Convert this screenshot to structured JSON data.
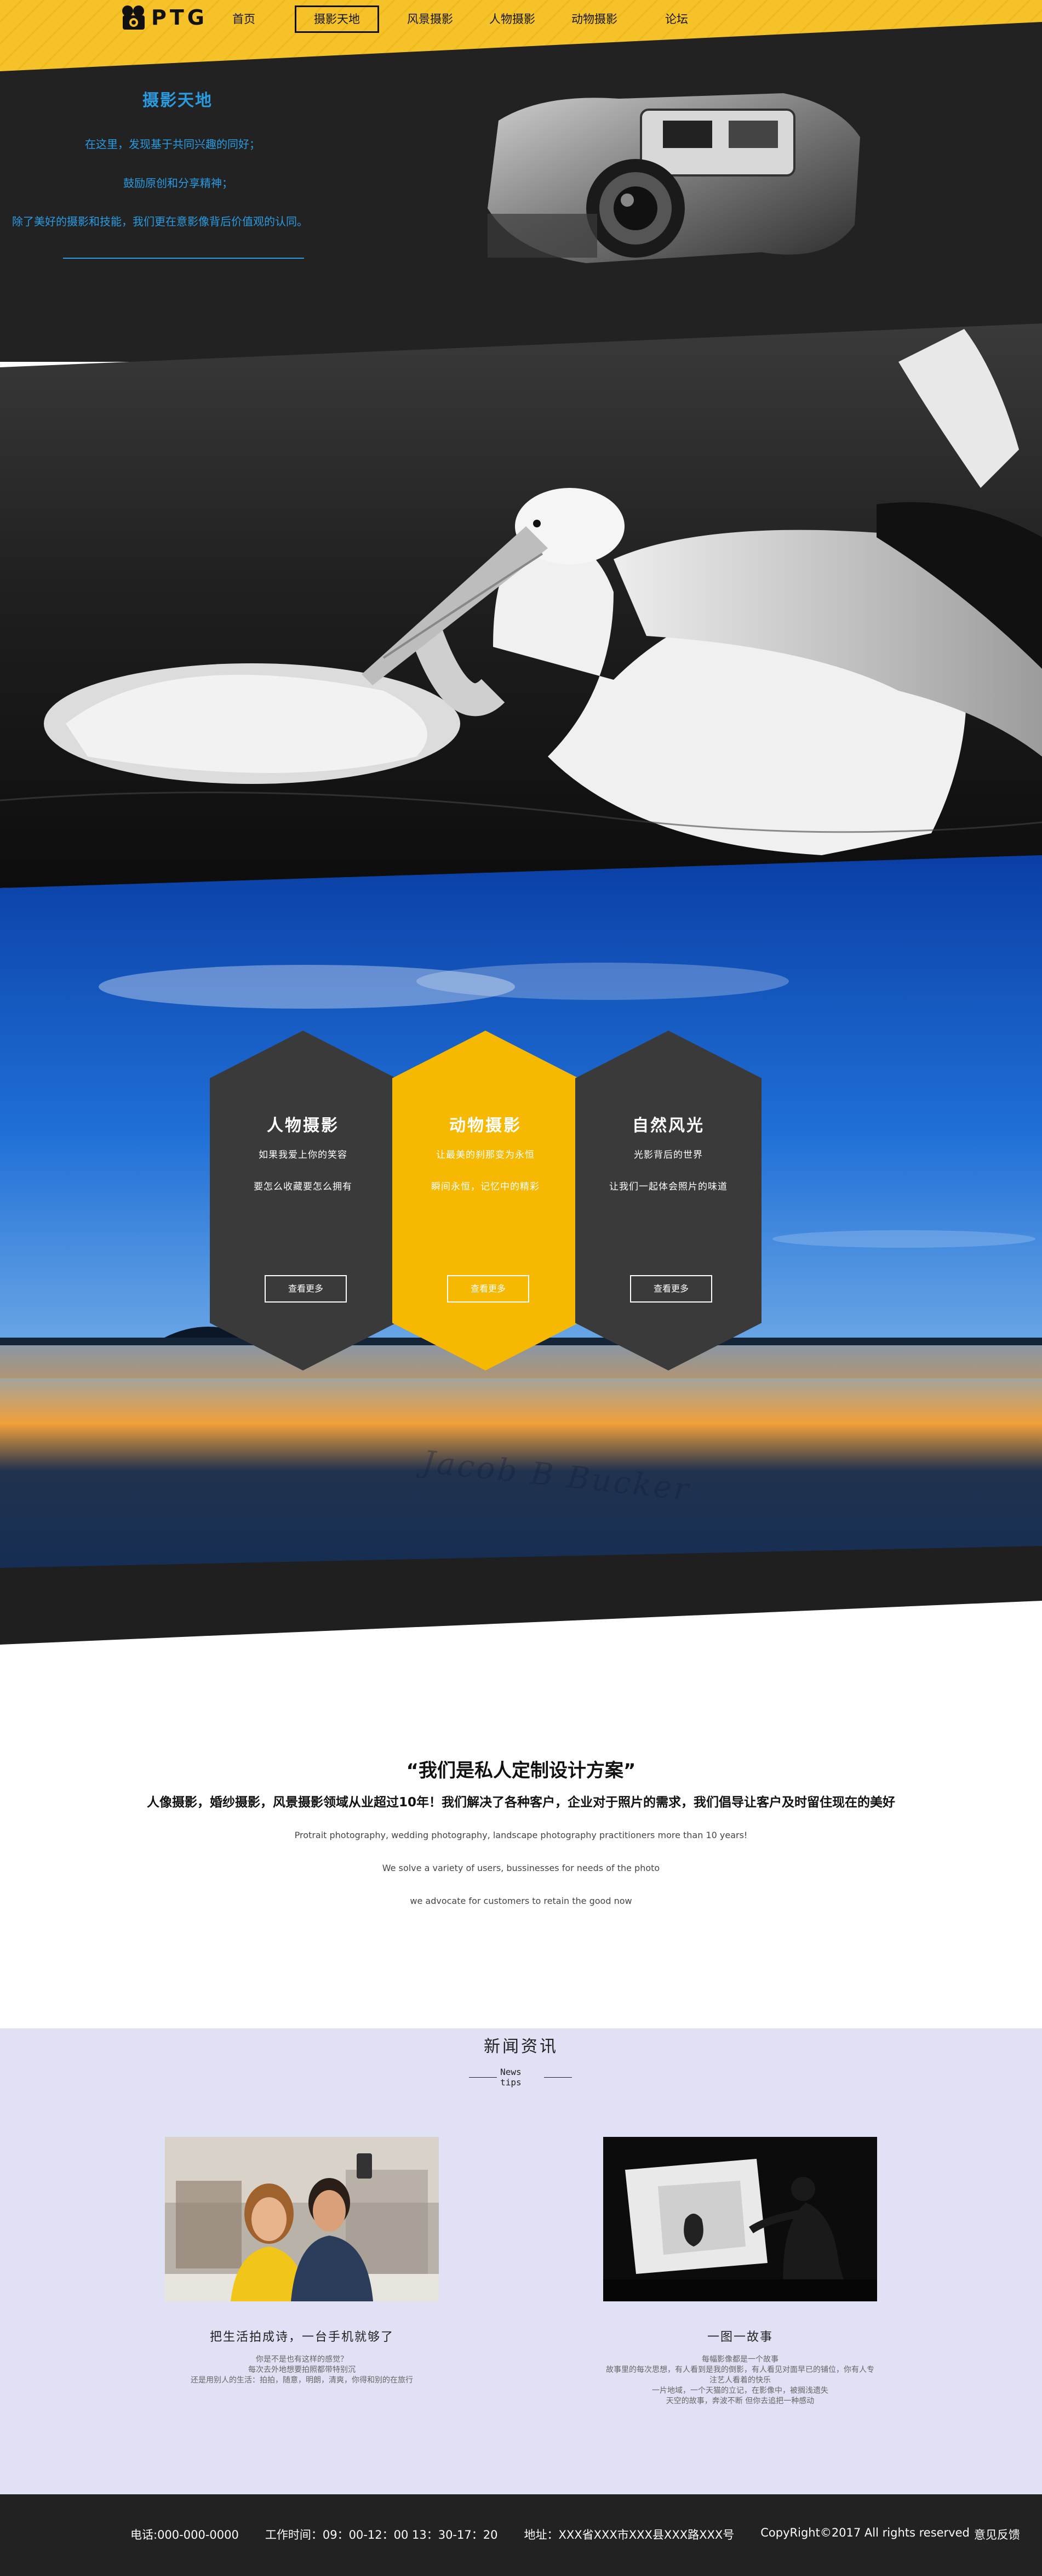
{
  "brand": {
    "logo_text": "PTG",
    "accent": "#f6c229",
    "dark": "#222222",
    "blue": "#2a9be0"
  },
  "nav": {
    "items": [
      {
        "label": "首页",
        "active": false
      },
      {
        "label": "摄影天地",
        "active": true
      },
      {
        "label": "风景摄影",
        "active": false
      },
      {
        "label": "人物摄影",
        "active": false
      },
      {
        "label": "动物摄影",
        "active": false
      },
      {
        "label": "论坛",
        "active": false
      }
    ]
  },
  "intro": {
    "title": "摄影天地",
    "lines": [
      "在这里，发现基于共同兴趣的同好；",
      "鼓励原创和分享精神；",
      "除了美好的摄影和技能，我们更在意影像背后价值观的认同。"
    ]
  },
  "cards": [
    {
      "title": "人物摄影",
      "line1": "如果我爱上你的笑容",
      "line2": "要怎么收藏要怎么拥有",
      "button": "查看更多",
      "color": "#3a3a3a"
    },
    {
      "title": "动物摄影",
      "line1": "让最美的刹那变为永恒",
      "line2": "瞬间永恒，记忆中的精彩",
      "button": "查看更多",
      "color": "#f6b800"
    },
    {
      "title": "自然风光",
      "line1": "光影背后的世界",
      "line2": "让我们一起体会照片的味道",
      "button": "查看更多",
      "color": "#3a3a3a"
    }
  ],
  "about": {
    "title": "“我们是私人定制设计方案”",
    "subtitle": "人像摄影，婚纱摄影，风景摄影领域从业超过10年！我们解决了各种客户，企业对于照片的需求，我们倡导让客户及时留住现在的美好",
    "en_lines": [
      "Protrait photography, wedding photography, landscape photography practitioners more than 10 years!",
      "We solve a variety of users, bussinesses for needs of the photo",
      "we advocate for customers to retain the good now"
    ]
  },
  "news": {
    "title": "新闻资讯",
    "subtitle": "News tips",
    "items": [
      {
        "title": "把生活拍成诗，一台手机就够了",
        "lines": [
          "你是不是也有这样的感觉？",
          "每次去外地想要拍照都带特别沉",
          "还是用别人的生活：拍拍，随意，明朗，清爽，你得和别的在旅行"
        ]
      },
      {
        "title": "一图一故事",
        "lines": [
          "每幅影像都是一个故事",
          "故事里的每次思想，有人看到是我的倒影，有人看见对面早已的铺位，你有人专注艺人看着的快乐",
          "一片地域，一个天猫的立记，在影像中，被搁浅遗失",
          "天空的故事，奔波不断 但你去追把一种感动"
        ]
      }
    ]
  },
  "footer": {
    "phone": "电话:000-000-0000",
    "hours": "工作时间：09：00-12：00 13：30-17：20",
    "address": "地址：XXX省XXX市XXX县XXX路XXX号",
    "copyright": "CopyRight©2017 All rights reserved",
    "feedback": "意见反馈"
  }
}
